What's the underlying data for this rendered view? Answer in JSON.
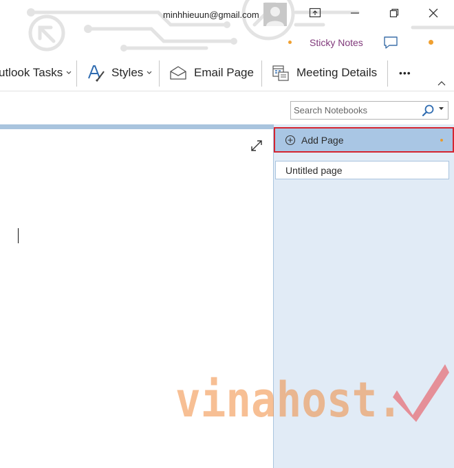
{
  "titlebar": {
    "account_email": "minhhieuun@gmail.com",
    "sticky_notes": "Sticky Notes"
  },
  "ribbon": {
    "items": [
      {
        "label": "utlook Tasks",
        "icon": "chevron-down-icon"
      },
      {
        "label": "Styles",
        "icon": "styles-icon"
      },
      {
        "label": "Email Page",
        "icon": "envelope-icon"
      },
      {
        "label": "Meeting Details",
        "icon": "meeting-details-icon"
      },
      {
        "label": "•••",
        "icon": "more-icon"
      }
    ]
  },
  "search": {
    "placeholder": "Search Notebooks"
  },
  "pages": {
    "add_label": "Add Page",
    "items": [
      {
        "title": "Untitled page"
      }
    ]
  },
  "watermark": {
    "text": "vinahost."
  },
  "colors": {
    "accent_blue": "#a9c4de",
    "pagelist_bg": "#e1ebf6",
    "highlight_red": "#d5232f",
    "watermark_orange": "#f08a3c"
  }
}
